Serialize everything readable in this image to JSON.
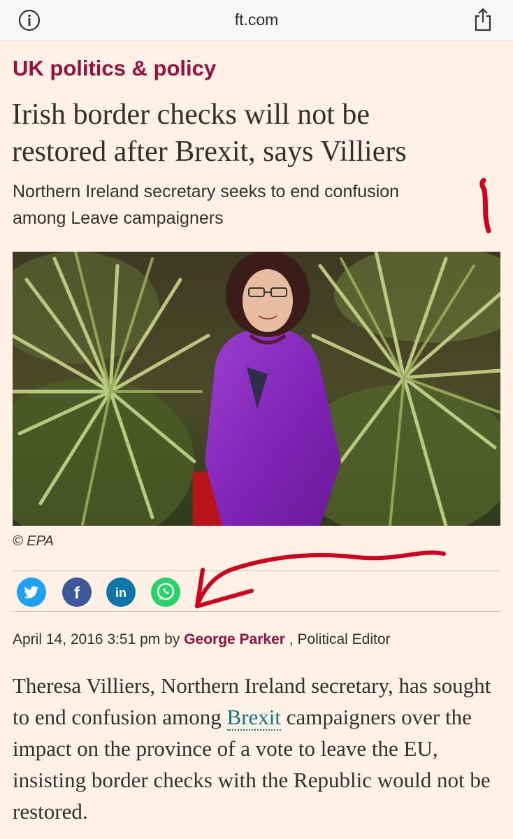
{
  "browser": {
    "url": "ft.com",
    "info_icon": "info-circle-icon",
    "share_icon": "share-icon"
  },
  "article": {
    "section": "UK politics & policy",
    "headline_line1": "Irish border checks will not be",
    "headline_line2": "restored after Brexit, says Villiers",
    "standfirst_line1": "Northern Ireland secretary seeks to end confusion",
    "standfirst_line2": "among Leave campaigners",
    "image_caption": "© EPA",
    "share_buttons": [
      {
        "name": "twitter",
        "icon": "twitter-icon",
        "color": "#1da1f2"
      },
      {
        "name": "facebook",
        "icon": "facebook-icon",
        "color": "#3b5998"
      },
      {
        "name": "linkedin",
        "icon": "linkedin-icon",
        "color": "#0e76a8"
      },
      {
        "name": "whatsapp",
        "icon": "whatsapp-icon",
        "color": "#25d366"
      }
    ],
    "date": "April 14, 2016 3:51 pm",
    "by": "by",
    "author": "George Parker",
    "author_role": ", Political Editor",
    "body_part1": "Theresa Villiers, Northern Ireland secretary, has sought to end confusion among ",
    "body_link": "Brexit",
    "body_part2": " campaigners over the impact on the province of a vote to leave the EU, insisting border checks with the Republic would not be restored."
  },
  "colors": {
    "background": "#fff1e5",
    "section": "#990f3d",
    "link": "#0d7680",
    "annotation": "#d0021b"
  }
}
